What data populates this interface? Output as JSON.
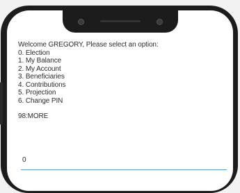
{
  "dialog": {
    "welcome": "Welcome GREGORY, Please select an option:",
    "options": [
      "0. Election",
      "1. My Balance",
      "2. My Account",
      "3. Beneficiaries",
      "4. Contributions",
      "5. Projection",
      "6. Change PIN"
    ],
    "more": "98:MORE"
  },
  "input": {
    "value": "0"
  },
  "colors": {
    "accent": "#5a9fd4",
    "bezel": "#1c1c1c",
    "screen": "#ffffff"
  }
}
